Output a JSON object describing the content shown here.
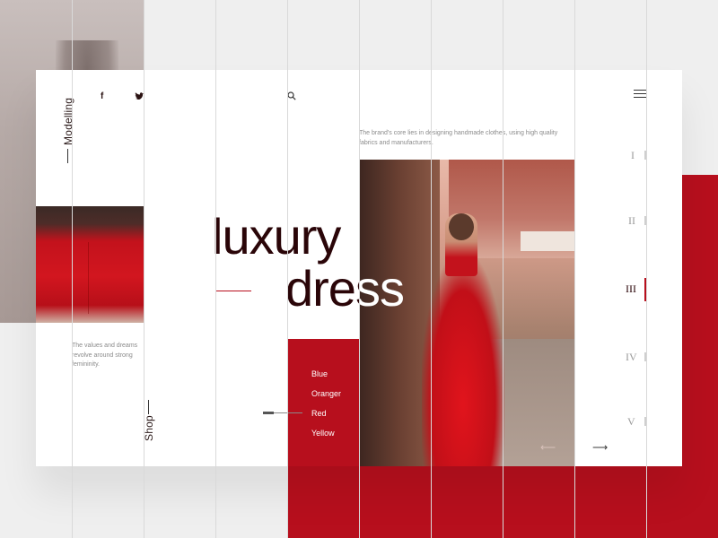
{
  "header": {
    "side_label": "Modelling",
    "social": [
      {
        "icon": "facebook-icon",
        "glyph": "f"
      },
      {
        "icon": "twitter-icon",
        "glyph": "🐦"
      }
    ]
  },
  "intro": {
    "description": "The brand's core lies in designing handmade clothes, using high quality fabrics and manufacturers."
  },
  "hero": {
    "title_line1": "luxury",
    "title_line2": "dress"
  },
  "values_text": "The values and dreams revolve around strong femininity.",
  "shop_label": "Shop",
  "colors": [
    "Blue",
    "Oranger",
    "Red",
    "Yellow"
  ],
  "slides": [
    "I",
    "II",
    "III",
    "IV",
    "V"
  ],
  "active_slide": 3,
  "arrows": {
    "prev": "⟵",
    "next": "⟶"
  },
  "theme": {
    "accent": "#b70f1d",
    "dark": "#2a0508"
  }
}
